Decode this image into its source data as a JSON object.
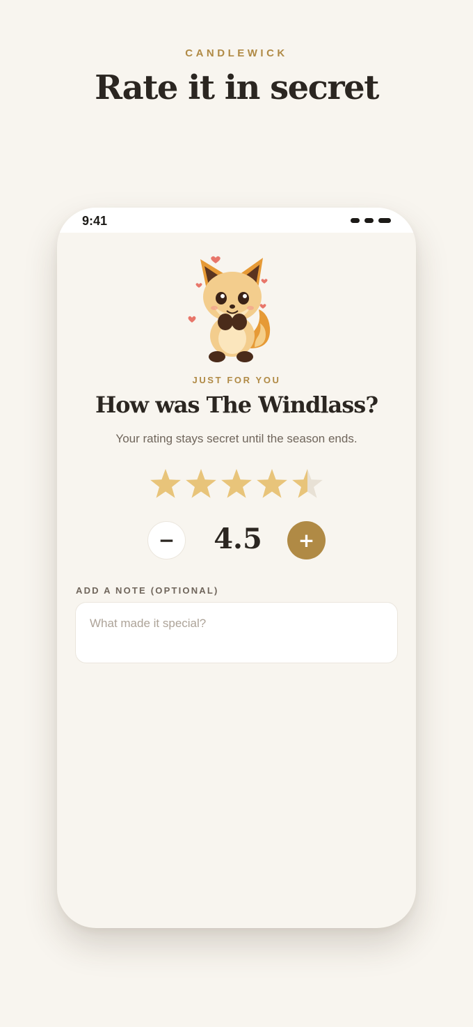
{
  "header": {
    "brand": "CANDLEWICK",
    "title": "Rate it in secret"
  },
  "status_bar": {
    "time": "9:41"
  },
  "rating_card": {
    "eyebrow": "JUST FOR YOU",
    "question": "How was The Windlass?",
    "subtitle": "Your rating stays secret until the season ends.",
    "max_stars": 5,
    "rating": 4.5,
    "rating_display": "4.5",
    "decrement_label": "−",
    "increment_label": "+"
  },
  "note": {
    "label": "ADD A NOTE (OPTIONAL)",
    "placeholder": "What made it special?",
    "value": ""
  },
  "colors": {
    "accent": "#b08a45",
    "star_filled": "#e8c47a",
    "star_empty": "#e8e1d5",
    "background": "#f8f5ef",
    "text_dark": "#2b2621"
  },
  "icons": {
    "mascot": "fox-mascot-icon",
    "star": "star-icon"
  }
}
